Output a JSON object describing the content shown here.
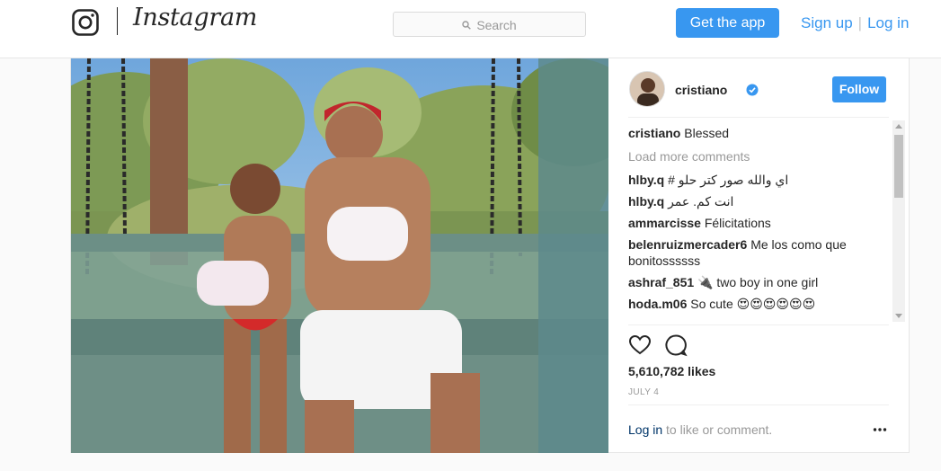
{
  "header": {
    "wordmark": "Instagram",
    "search_placeholder": "Search",
    "get_app_label": "Get the app",
    "signup_label": "Sign up",
    "separator": "|",
    "login_label": "Log in"
  },
  "post": {
    "username": "cristiano",
    "follow_label": "Follow",
    "comments": [
      {
        "user": "cristiano",
        "text": "Blessed"
      },
      {
        "user": "hlby.q",
        "text": "# اي والله صور كتر حلو"
      },
      {
        "user": "hlby.q",
        "text": "انت كم. عمر"
      },
      {
        "user": "ammarcisse",
        "text": "Félicitations"
      },
      {
        "user": "belenruizmercader6",
        "text": "Me los como que bonitossssss"
      },
      {
        "user": "ashraf_851",
        "text": "🔌 two boy in one girl"
      },
      {
        "user": "hoda.m06",
        "text": "So cute 😍😍😍😍😍😍"
      }
    ],
    "load_more_label": "Load more comments",
    "likes": "5,610,782 likes",
    "date": "JULY 4",
    "footer_login_label": "Log in",
    "footer_suffix": "to like or comment."
  },
  "colors": {
    "accent": "#3897f0",
    "border": "#e6e6e6",
    "muted": "#999999"
  },
  "icons": {
    "logo": "camera-icon",
    "search": "search-icon",
    "verified": "verified-badge-icon",
    "like": "heart-icon",
    "comment": "comment-bubble-icon",
    "options": "more-options-icon"
  }
}
